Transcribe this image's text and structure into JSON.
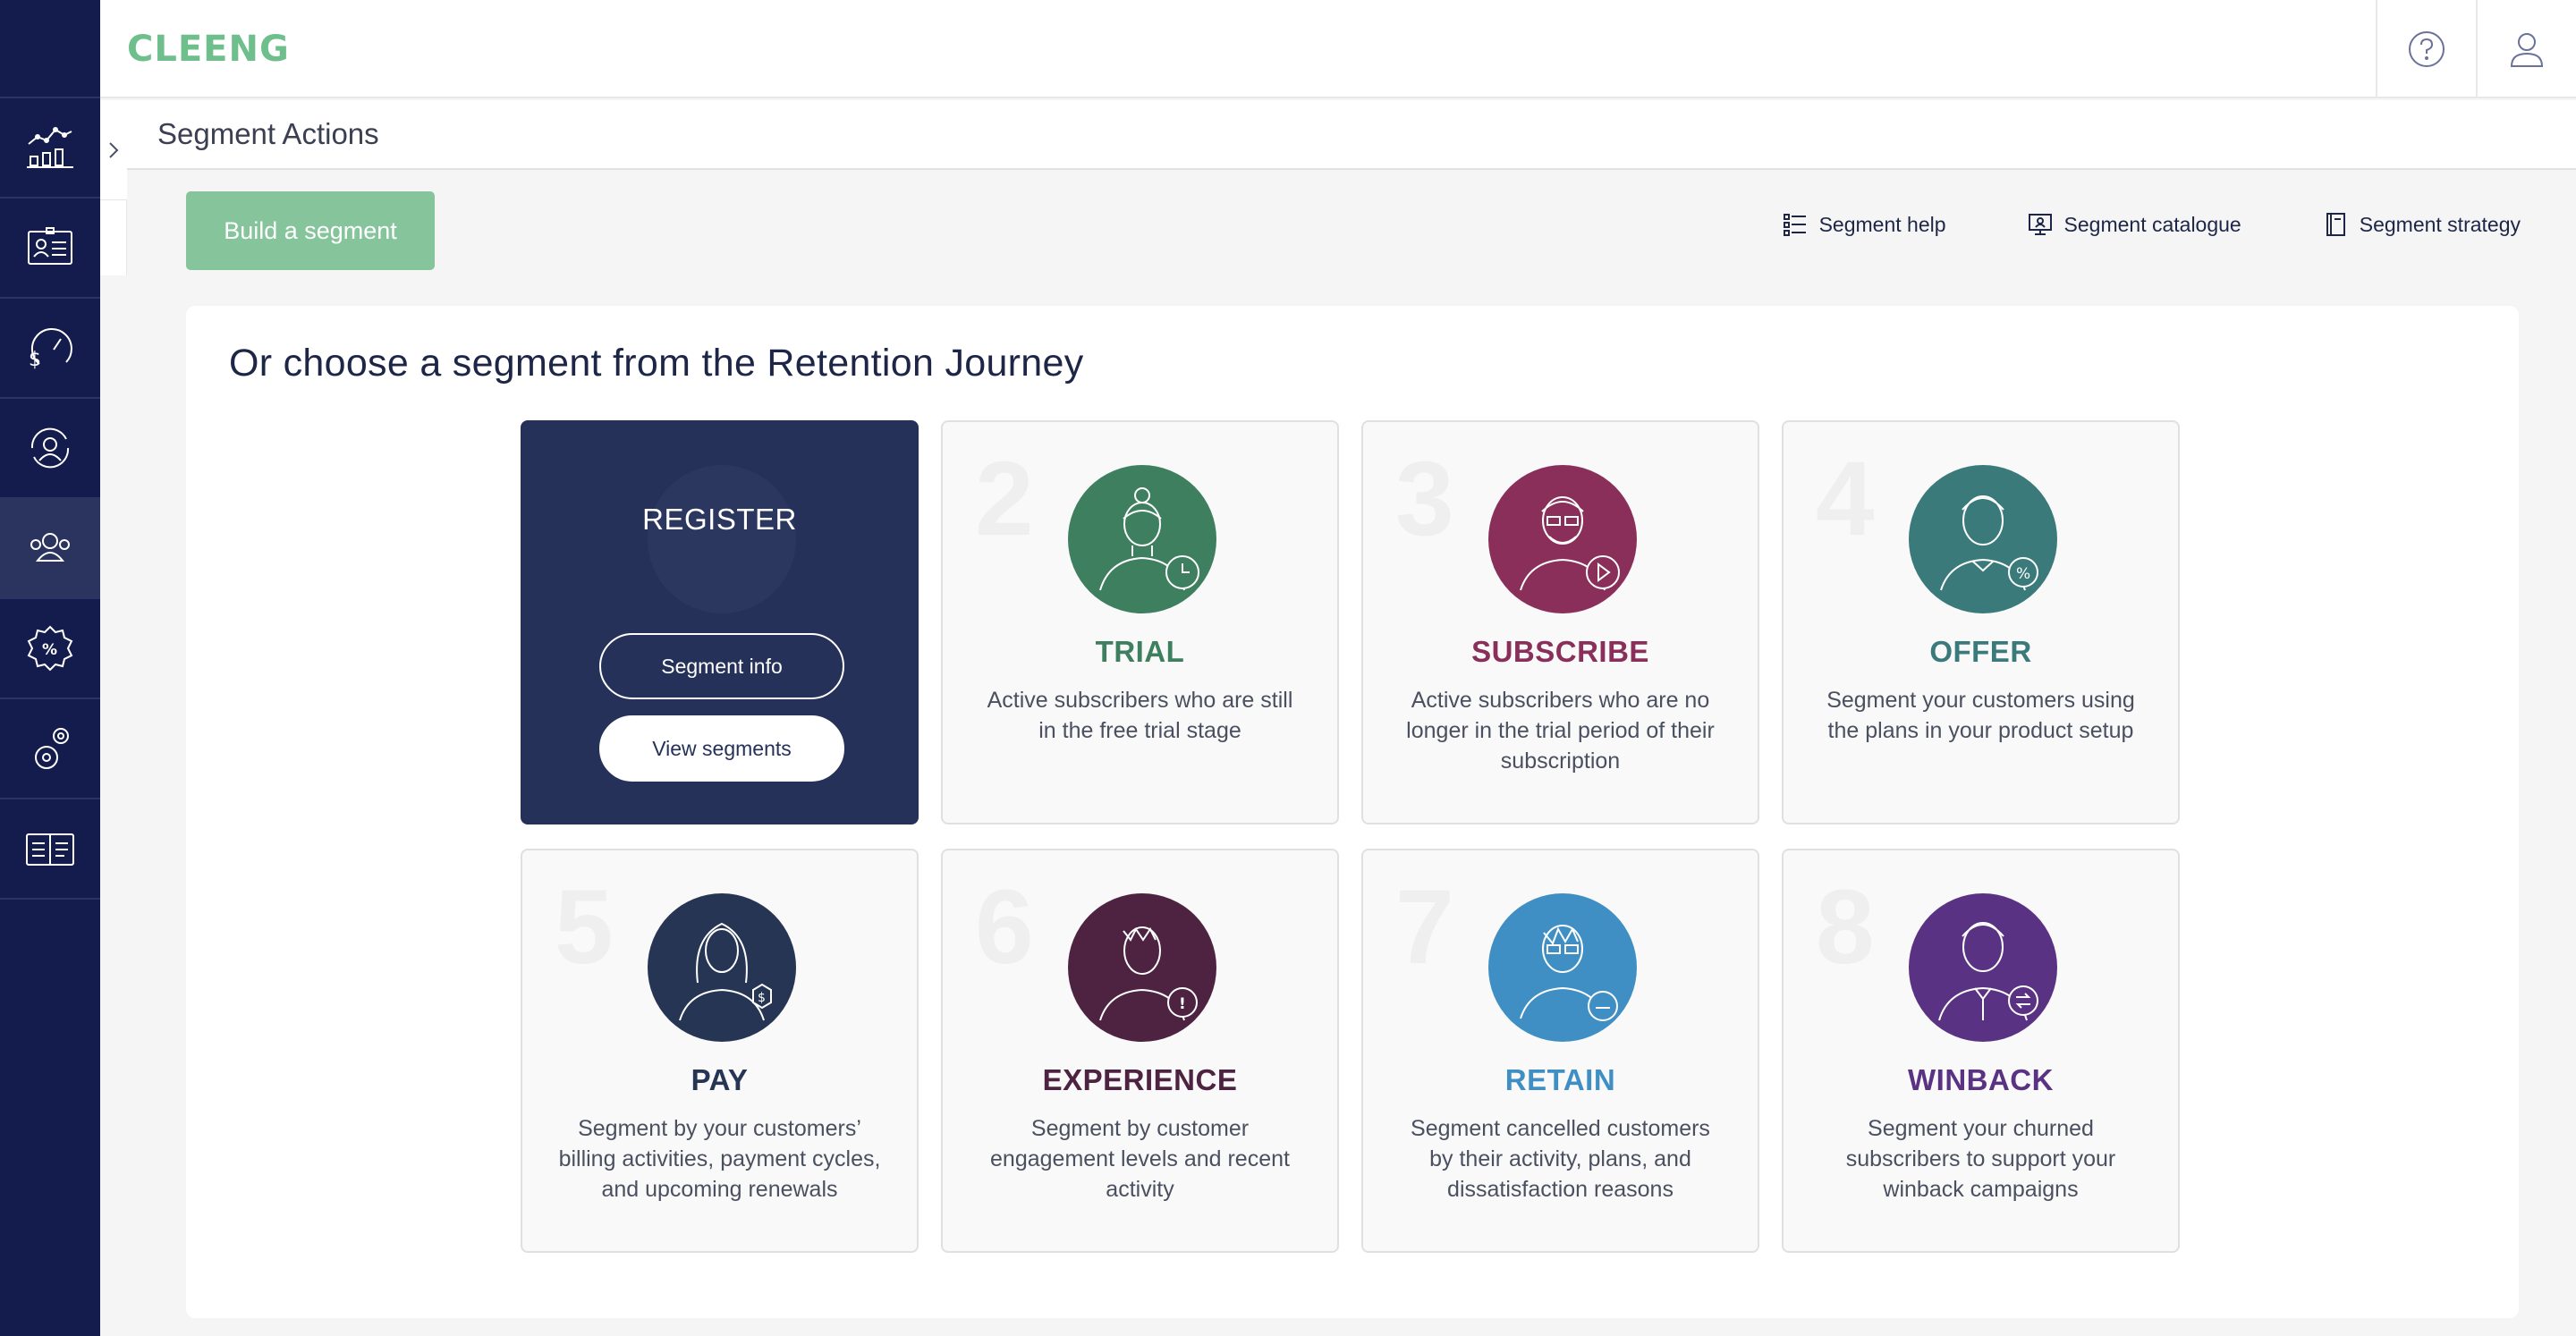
{
  "app": {
    "logo_text": "CLEENG"
  },
  "header": {
    "help_icon": "help-circle-icon",
    "user_icon": "user-icon"
  },
  "sidebar": {
    "items": [
      {
        "icon": "analytics-icon"
      },
      {
        "icon": "customer-card-icon"
      },
      {
        "icon": "revenue-dashboard-icon"
      },
      {
        "icon": "retention-user-icon"
      },
      {
        "icon": "segments-users-icon",
        "active": true
      },
      {
        "icon": "offers-percent-badge-icon"
      },
      {
        "icon": "settings-gears-icon"
      },
      {
        "icon": "documentation-book-icon"
      }
    ]
  },
  "page": {
    "title": "Segment Actions"
  },
  "actions": {
    "build_label": "Build a segment",
    "links": [
      {
        "label": "Segment help",
        "icon": "list-icon"
      },
      {
        "label": "Segment catalogue",
        "icon": "monitor-icon"
      },
      {
        "label": "Segment strategy",
        "icon": "notebook-icon"
      }
    ]
  },
  "journey": {
    "heading": "Or choose a segment from the Retention Journey",
    "register": {
      "name": "REGISTER",
      "info_label": "Segment info",
      "view_label": "View segments"
    },
    "stages": [
      {
        "num": "2",
        "name": "TRIAL",
        "color": "#3d7f5e",
        "desc": "Active subscribers who are still in the free trial stage"
      },
      {
        "num": "3",
        "name": "SUBSCRIBE",
        "color": "#8a2f5a",
        "desc": "Active subscribers who are no longer in the trial period of their subscription"
      },
      {
        "num": "4",
        "name": "OFFER",
        "color": "#3a7a7a",
        "desc": "Segment your customers using the plans in your product setup"
      },
      {
        "num": "5",
        "name": "PAY",
        "color": "#263553",
        "desc": "Segment by your customers’ billing activities, payment cycles, and upcoming renewals"
      },
      {
        "num": "6",
        "name": "EXPERIENCE",
        "color": "#4d2341",
        "desc": "Segment by customer engagement levels and recent activity"
      },
      {
        "num": "7",
        "name": "RETAIN",
        "color": "#3f8fc4",
        "desc": "Segment cancelled customers by their activity, plans, and dissatisfaction reasons"
      },
      {
        "num": "8",
        "name": "WINBACK",
        "color": "#5a3283",
        "desc": "Segment your churned subscribers to support your winback campaigns"
      }
    ]
  }
}
